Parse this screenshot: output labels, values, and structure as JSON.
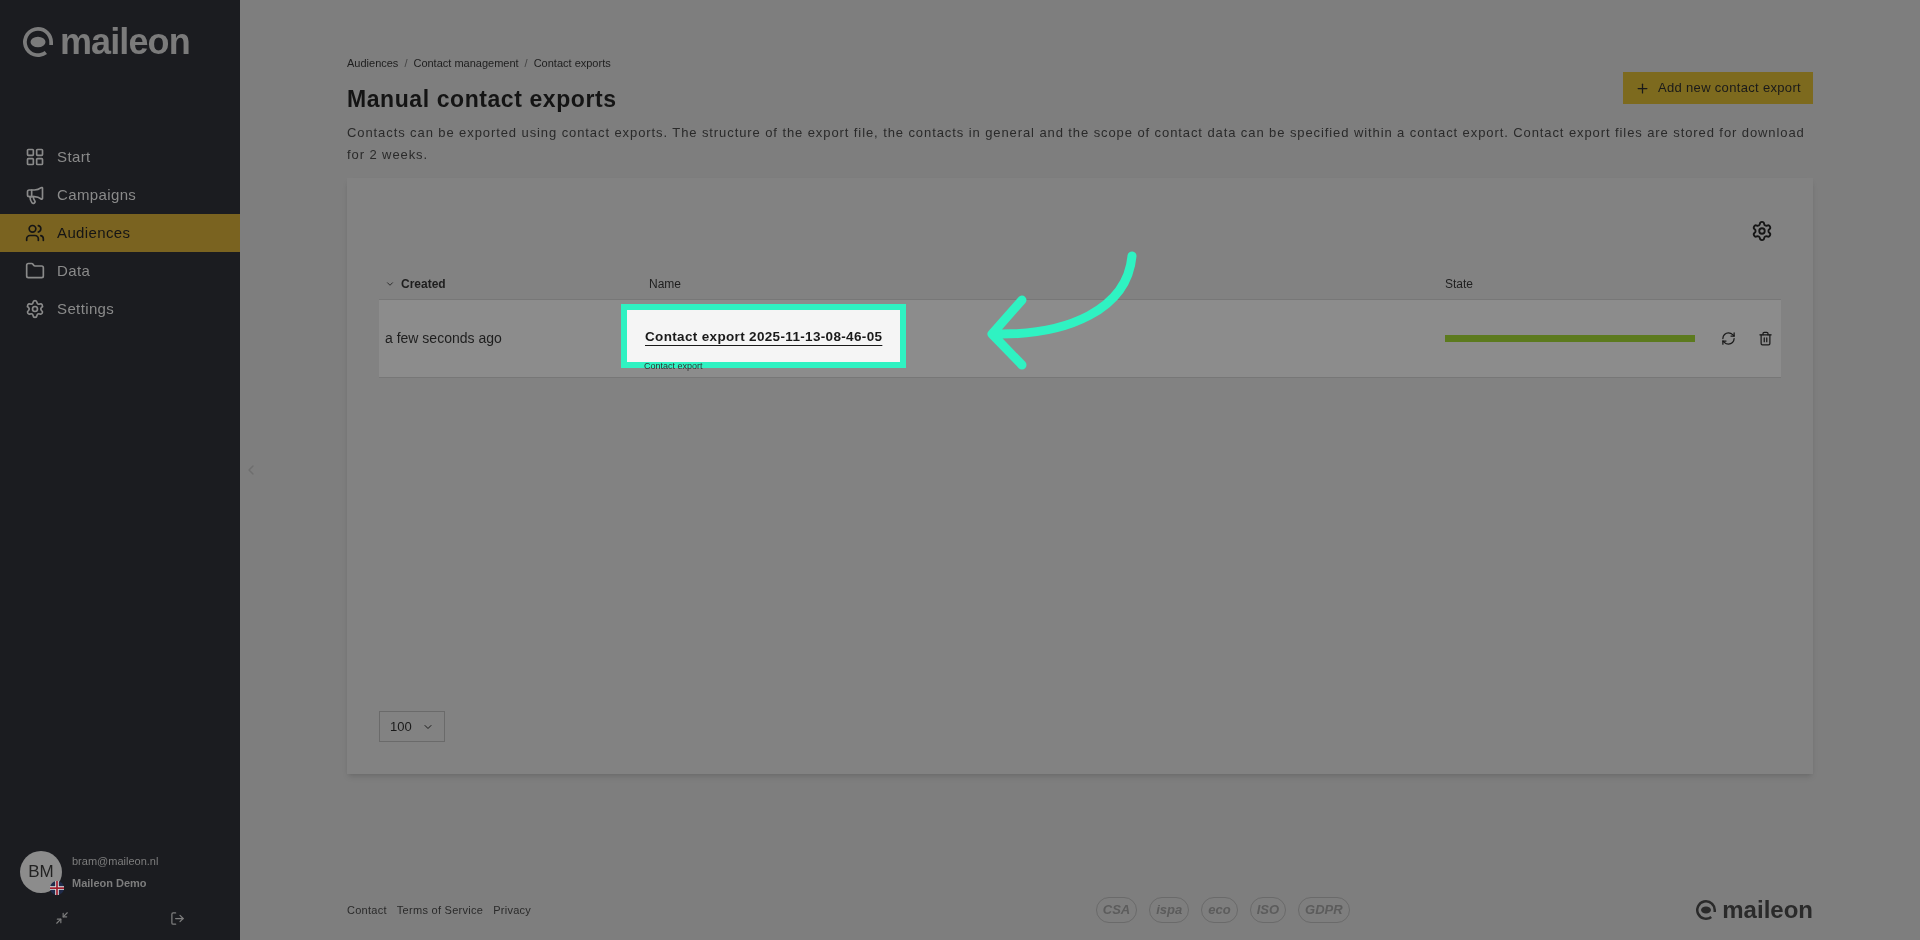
{
  "sidebar": {
    "logo": "maileon",
    "items": [
      {
        "label": "Start",
        "selected": false
      },
      {
        "label": "Campaigns",
        "selected": false
      },
      {
        "label": "Audiences",
        "selected": true
      },
      {
        "label": "Data",
        "selected": false
      },
      {
        "label": "Settings",
        "selected": false
      }
    ],
    "user": {
      "initials": "BM",
      "email": "bram@maileon.nl",
      "account": "Maileon Demo"
    }
  },
  "breadcrumb": [
    {
      "kind": "link",
      "text": "Audiences"
    },
    {
      "kind": "separator",
      "text": "/"
    },
    {
      "kind": "link",
      "text": "Contact management"
    },
    {
      "kind": "separator",
      "text": "/"
    },
    {
      "kind": "link",
      "text": "Contact exports"
    }
  ],
  "title": "Manual contact exports",
  "description": "Contacts can be exported using contact exports. The structure of the export file, the contacts in general and the scope of contact data can be specified within a contact export. Contact export files are stored for download for 2 weeks.",
  "add_button": {
    "label": "Add new contact export"
  },
  "table": {
    "columns": [
      {
        "label": "Created",
        "sorted": true
      },
      {
        "label": "Name",
        "sorted": false
      },
      {
        "label": "State",
        "sorted": false
      }
    ],
    "rows": [
      {
        "created": "a few seconds ago",
        "name": "Contact export 2025-11-13-08-46-05",
        "subtitle": "Contact export",
        "level": 1,
        "highlighted": true
      }
    ]
  },
  "page_size": "100",
  "footer": {
    "links": [
      "Contact",
      "Terms of Service",
      "Privacy"
    ],
    "badges": [
      "CSA",
      "ispa",
      "eco",
      "ISO",
      "GDPR"
    ],
    "logo": "maileon"
  }
}
